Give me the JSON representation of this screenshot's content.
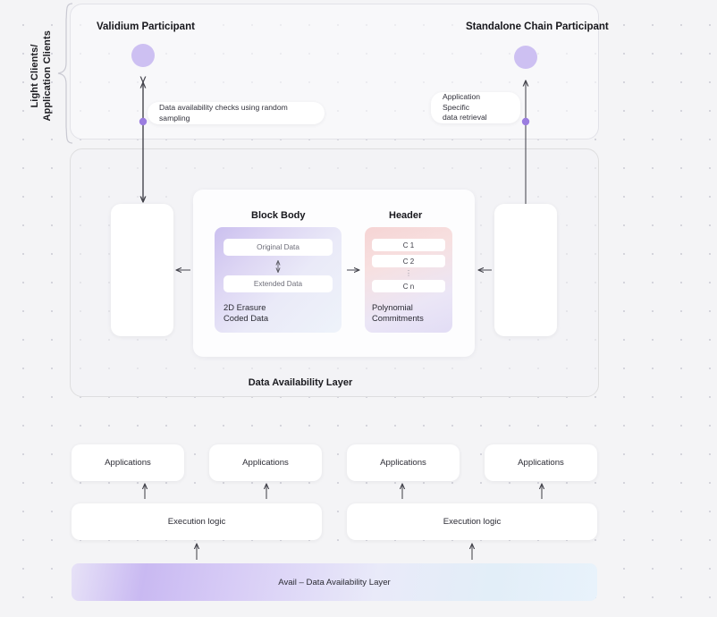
{
  "diagram": {
    "background_color": "#f4f4f6",
    "accent_color": "#9b7de0",
    "dot_color": "#d2d2da"
  },
  "clients_section": {
    "brace_label": "Light Clients/\nApplication Clients",
    "participants": [
      {
        "title": "Validium Participant",
        "node": "participant-node"
      },
      {
        "title": "Standalone Chain Participant",
        "node": "participant-node"
      }
    ],
    "callouts": [
      {
        "text": "Data availability checks using random sampling"
      },
      {
        "text": "Application Specific\ndata retrieval"
      }
    ]
  },
  "da_layer": {
    "label": "Data Availability Layer",
    "side_boxes": [
      {
        "name": "left-node-box",
        "text": ""
      },
      {
        "name": "right-node-box",
        "text": ""
      }
    ],
    "block_body": {
      "heading": "Block Body",
      "rows": [
        {
          "label": "Original Data"
        },
        {
          "label": "Extended Data"
        }
      ],
      "caption": "2D Erasure\nCoded Data",
      "gradient_from": "#cbc0ef",
      "gradient_to": "#eef3fa"
    },
    "header": {
      "heading": "Header",
      "commitments": [
        {
          "label": "C 1"
        },
        {
          "label": "C 2"
        },
        {
          "label": "C n"
        }
      ],
      "ellipsis": "⋮",
      "caption": "Polynomial\nCommitments",
      "gradient_from": "#f6d4d4",
      "gradient_to": "#e2ddf5"
    }
  },
  "stack": {
    "applications": [
      {
        "label": "Applications"
      },
      {
        "label": "Applications"
      },
      {
        "label": "Applications"
      },
      {
        "label": "Applications"
      }
    ],
    "execution": [
      {
        "label": "Execution logic"
      },
      {
        "label": "Execution logic"
      }
    ],
    "base_layer": {
      "label": "Avail – Data Availability Layer"
    }
  }
}
